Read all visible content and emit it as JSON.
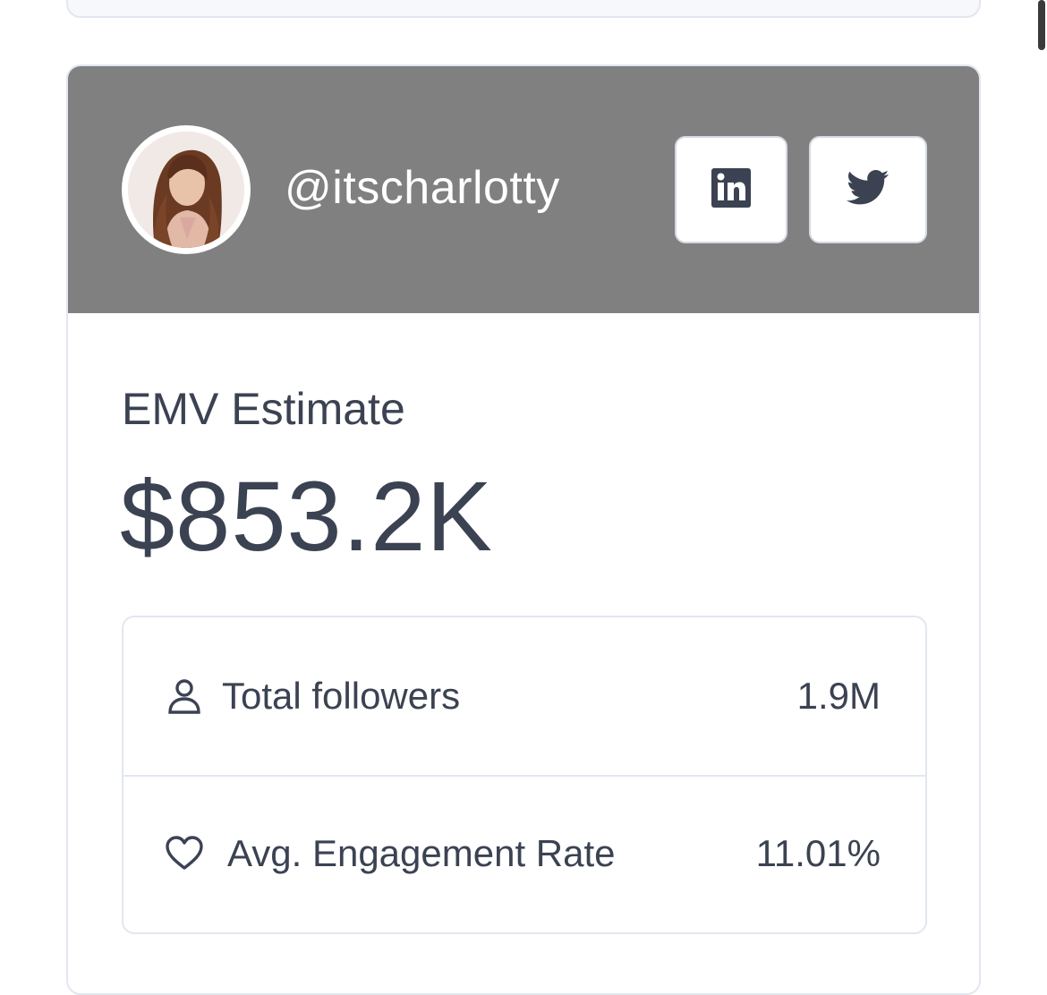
{
  "profile": {
    "handle": "@itscharlotty",
    "avatar_alt": "profile photo"
  },
  "social": {
    "linkedin_icon": "linkedin-icon",
    "twitter_icon": "twitter-icon"
  },
  "emv": {
    "label": "EMV Estimate",
    "value": "$853.2K"
  },
  "stats": [
    {
      "icon": "user-icon",
      "label": "Total followers",
      "value": "1.9M"
    },
    {
      "icon": "heart-icon",
      "label": "Avg. Engagement Rate",
      "value": "11.01%"
    }
  ],
  "colors": {
    "header_bg": "#808080",
    "text": "#3b4252",
    "border": "#e2e7ef"
  }
}
